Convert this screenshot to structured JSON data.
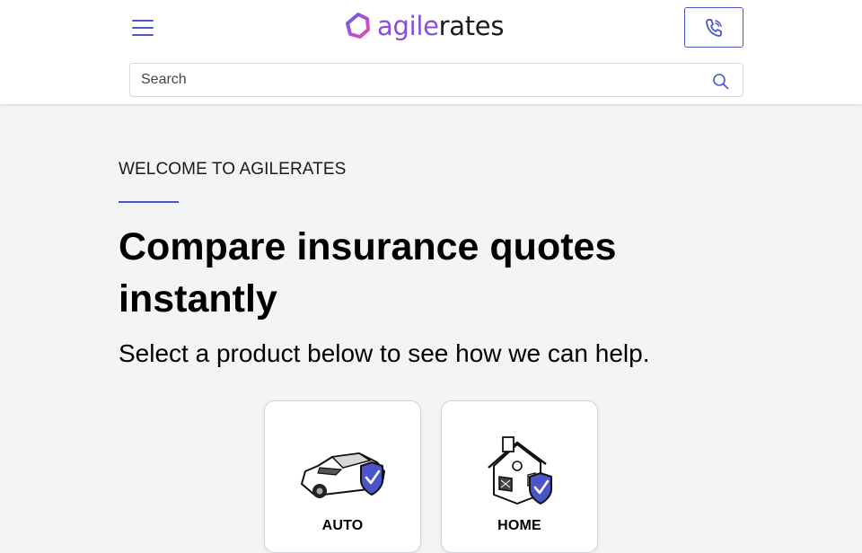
{
  "header": {
    "logo": {
      "part1": "agile",
      "part2": "rates"
    },
    "menu_icon": "hamburger-menu-icon",
    "phone_icon": "phone-icon"
  },
  "search": {
    "placeholder": "Search",
    "value": "",
    "icon": "search-icon"
  },
  "hero": {
    "eyebrow": "WELCOME TO AGILERATES",
    "headline": "Compare insurance quotes instantly",
    "subhead": "Select a product below to see how we can help."
  },
  "products": [
    {
      "label": "AUTO",
      "icon": "car-shield-icon"
    },
    {
      "label": "HOME",
      "icon": "house-shield-icon"
    }
  ],
  "colors": {
    "accent": "#4b55c9",
    "logo_purple": "#8a4fd6",
    "background": "#f2f4f6"
  }
}
